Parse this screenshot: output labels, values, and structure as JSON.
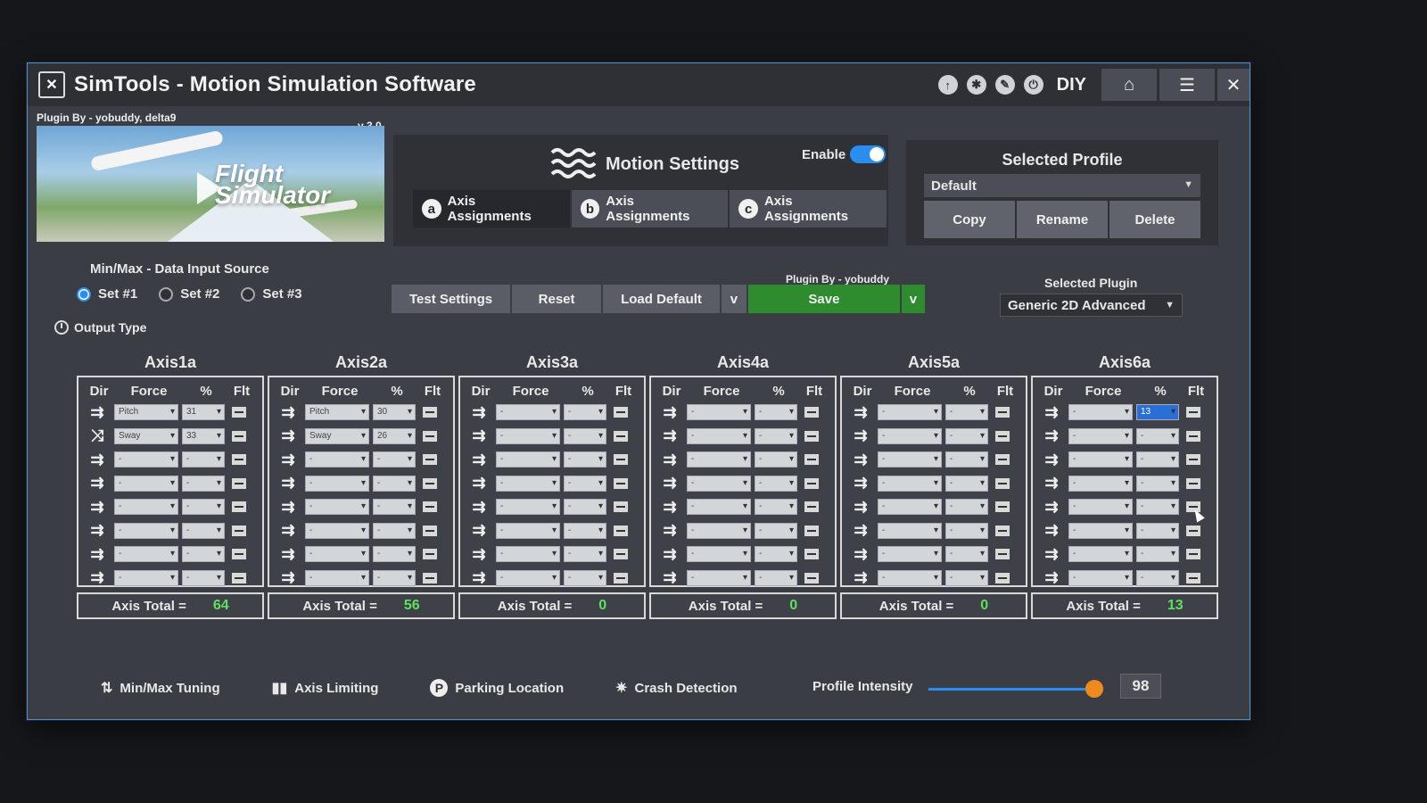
{
  "app": {
    "title": "SimTools - Motion Simulation Software",
    "diy_label": "DIY",
    "title_icons": [
      "upload-icon",
      "gear-icon",
      "pen-icon",
      "power-icon"
    ],
    "buttons": [
      "home-icon",
      "menu-icon",
      "close-icon"
    ]
  },
  "plugin_header": {
    "by": "Plugin By - yobuddy, delta9",
    "version": "v 3.0",
    "banner_text": "Flight Simulator"
  },
  "motion": {
    "title": "Motion Settings",
    "enable_label": "Enable",
    "enabled": true,
    "tabs": [
      {
        "badge": "a",
        "label": "Axis Assignments",
        "active": true
      },
      {
        "badge": "b",
        "label": "Axis Assignments",
        "active": false
      },
      {
        "badge": "c",
        "label": "Axis Assignments",
        "active": false
      }
    ]
  },
  "profile": {
    "title": "Selected Profile",
    "value": "Default",
    "buttons": [
      "Copy",
      "Rename",
      "Delete"
    ]
  },
  "input_source": {
    "label": "Min/Max - Data Input Source",
    "options": [
      "Set #1",
      "Set #2",
      "Set #3"
    ],
    "selected": "Set #1",
    "output_type": "Output Type"
  },
  "actions": {
    "test": "Test Settings",
    "reset": "Reset",
    "load_default": "Load Default",
    "dropdown": "v",
    "save": "Save",
    "plugin_by": "Plugin By - yobuddy"
  },
  "plugin": {
    "label": "Selected Plugin",
    "value": "Generic 2D Advanced"
  },
  "axis_headers": {
    "dir": "Dir",
    "force": "Force",
    "pct": "%",
    "flt": "Flt"
  },
  "axis_total_label": "Axis Total =",
  "axes": [
    {
      "name": "Axis1a",
      "total": "64",
      "rows": [
        {
          "force": "Pitch",
          "pct": "31",
          "inverted": false
        },
        {
          "force": "Sway",
          "pct": "33",
          "inverted": true
        },
        {
          "force": "-",
          "pct": "-",
          "inverted": false
        },
        {
          "force": "-",
          "pct": "-",
          "inverted": false
        },
        {
          "force": "-",
          "pct": "-",
          "inverted": false
        },
        {
          "force": "-",
          "pct": "-",
          "inverted": false
        },
        {
          "force": "-",
          "pct": "-",
          "inverted": false
        },
        {
          "force": "-",
          "pct": "-",
          "inverted": false
        }
      ]
    },
    {
      "name": "Axis2a",
      "total": "56",
      "rows": [
        {
          "force": "Pitch",
          "pct": "30",
          "inverted": false
        },
        {
          "force": "Sway",
          "pct": "26",
          "inverted": false
        },
        {
          "force": "-",
          "pct": "-",
          "inverted": false
        },
        {
          "force": "-",
          "pct": "-",
          "inverted": false
        },
        {
          "force": "-",
          "pct": "-",
          "inverted": false
        },
        {
          "force": "-",
          "pct": "-",
          "inverted": false
        },
        {
          "force": "-",
          "pct": "-",
          "inverted": false
        },
        {
          "force": "-",
          "pct": "-",
          "inverted": false
        }
      ]
    },
    {
      "name": "Axis3a",
      "total": "0",
      "rows": [
        {
          "force": "-",
          "pct": "-",
          "inverted": false
        },
        {
          "force": "-",
          "pct": "-",
          "inverted": false
        },
        {
          "force": "-",
          "pct": "-",
          "inverted": false
        },
        {
          "force": "-",
          "pct": "-",
          "inverted": false
        },
        {
          "force": "-",
          "pct": "-",
          "inverted": false
        },
        {
          "force": "-",
          "pct": "-",
          "inverted": false
        },
        {
          "force": "-",
          "pct": "-",
          "inverted": false
        },
        {
          "force": "-",
          "pct": "-",
          "inverted": false
        }
      ]
    },
    {
      "name": "Axis4a",
      "total": "0",
      "rows": [
        {
          "force": "-",
          "pct": "-",
          "inverted": false
        },
        {
          "force": "-",
          "pct": "-",
          "inverted": false
        },
        {
          "force": "-",
          "pct": "-",
          "inverted": false
        },
        {
          "force": "-",
          "pct": "-",
          "inverted": false
        },
        {
          "force": "-",
          "pct": "-",
          "inverted": false
        },
        {
          "force": "-",
          "pct": "-",
          "inverted": false
        },
        {
          "force": "-",
          "pct": "-",
          "inverted": false
        },
        {
          "force": "-",
          "pct": "-",
          "inverted": false
        }
      ]
    },
    {
      "name": "Axis5a",
      "total": "0",
      "rows": [
        {
          "force": "-",
          "pct": "-",
          "inverted": false
        },
        {
          "force": "-",
          "pct": "-",
          "inverted": false
        },
        {
          "force": "-",
          "pct": "-",
          "inverted": false
        },
        {
          "force": "-",
          "pct": "-",
          "inverted": false
        },
        {
          "force": "-",
          "pct": "-",
          "inverted": false
        },
        {
          "force": "-",
          "pct": "-",
          "inverted": false
        },
        {
          "force": "-",
          "pct": "-",
          "inverted": false
        },
        {
          "force": "-",
          "pct": "-",
          "inverted": false
        }
      ]
    },
    {
      "name": "Axis6a",
      "total": "13",
      "rows": [
        {
          "force": "-",
          "pct": "13",
          "inverted": false,
          "highlight": true
        },
        {
          "force": "-",
          "pct": "-",
          "inverted": false
        },
        {
          "force": "-",
          "pct": "-",
          "inverted": false
        },
        {
          "force": "-",
          "pct": "-",
          "inverted": false
        },
        {
          "force": "-",
          "pct": "-",
          "inverted": false
        },
        {
          "force": "-",
          "pct": "-",
          "inverted": false
        },
        {
          "force": "-",
          "pct": "-",
          "inverted": false
        },
        {
          "force": "-",
          "pct": "-",
          "inverted": false
        }
      ]
    }
  ],
  "bottom": {
    "minmax": "Min/Max Tuning",
    "limiting": "Axis Limiting",
    "parking": "Parking Location",
    "crash": "Crash Detection",
    "intensity_label": "Profile Intensity",
    "intensity_value": "98",
    "intensity_fraction": 0.98
  },
  "colors": {
    "accent": "#2a8ef0",
    "save": "#2e8b2e",
    "total_text": "#5fe05f",
    "slider_knob": "#f08a1c"
  }
}
